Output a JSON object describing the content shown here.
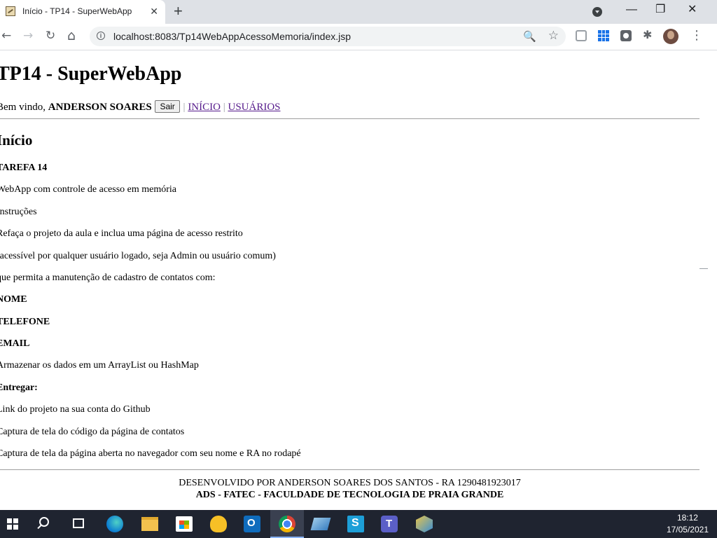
{
  "browser": {
    "tab_title": "Início - TP14 - SuperWebApp",
    "tab_close": "✕",
    "new_tab": "+",
    "url": "localhost:8083/Tp14WebAppAcessoMemoria/index.jsp",
    "window": {
      "minimize": "—",
      "maximize": "❐",
      "close": "✕"
    },
    "nav": {
      "back": "←",
      "forward": "→",
      "reload": "↻",
      "home": "⌂"
    },
    "menu": "⋮",
    "info_glyph": "i",
    "zoom_glyph": "🔍",
    "star_glyph": "☆",
    "puzzle_glyph": "✱"
  },
  "page": {
    "heading": "TP14 - SuperWebApp",
    "welcome_prefix": "Bem vindo,",
    "user_name": "ANDERSON SOARES",
    "logout_label": "Sair",
    "separator": "|",
    "nav_links": [
      "INÍCIO",
      "USUÁRIOS"
    ],
    "section_title": "Início",
    "lines": [
      {
        "text": "TAREFA 14",
        "bold": true
      },
      {
        "text": "WebApp com controle de acesso em memória",
        "bold": false
      },
      {
        "text": "Instruções",
        "bold": false
      },
      {
        "text": "Refaça o projeto da aula e inclua uma página de acesso restrito",
        "bold": false
      },
      {
        "text": "(acessível por qualquer usuário logado, seja Admin ou usuário comum)",
        "bold": false
      },
      {
        "text": "que permita a manutenção de cadastro de contatos com:",
        "bold": false
      },
      {
        "text": "NOME",
        "bold": true
      },
      {
        "text": "TELEFONE",
        "bold": true
      },
      {
        "text": "EMAIL",
        "bold": true
      },
      {
        "text": "Armazenar os dados em um ArrayList ou HashMap",
        "bold": false
      },
      {
        "text": "Entregar:",
        "bold": true
      },
      {
        "text": "Link do projeto na sua conta do Github",
        "bold": false
      },
      {
        "text": "Captura de tela do código da página de contatos",
        "bold": false
      },
      {
        "text": "Captura de tela da página aberta no navegador com seu nome e RA no rodapé",
        "bold": false
      }
    ],
    "footer_line1": "DESENVOLVIDO POR ANDERSON SOARES DOS SANTOS - RA 1290481923017",
    "footer_line2": "ADS - FATEC - FACULDADE DE TECNOLOGIA DE PRAIA GRANDE"
  },
  "taskbar": {
    "time": "18:12",
    "date": "17/05/2021",
    "apps": [
      "start-icon",
      "search-icon",
      "task-view-icon",
      "edge-icon",
      "file-explorer-icon",
      "store-icon",
      "keep-icon",
      "outlook-icon",
      "chrome-icon",
      "app-icon",
      "sql-icon",
      "teams-icon",
      "app-icon"
    ]
  },
  "colors": {
    "visited_link": "#551a8b",
    "tabstrip": "#dee1e6",
    "taskbar": "#1f2430"
  }
}
